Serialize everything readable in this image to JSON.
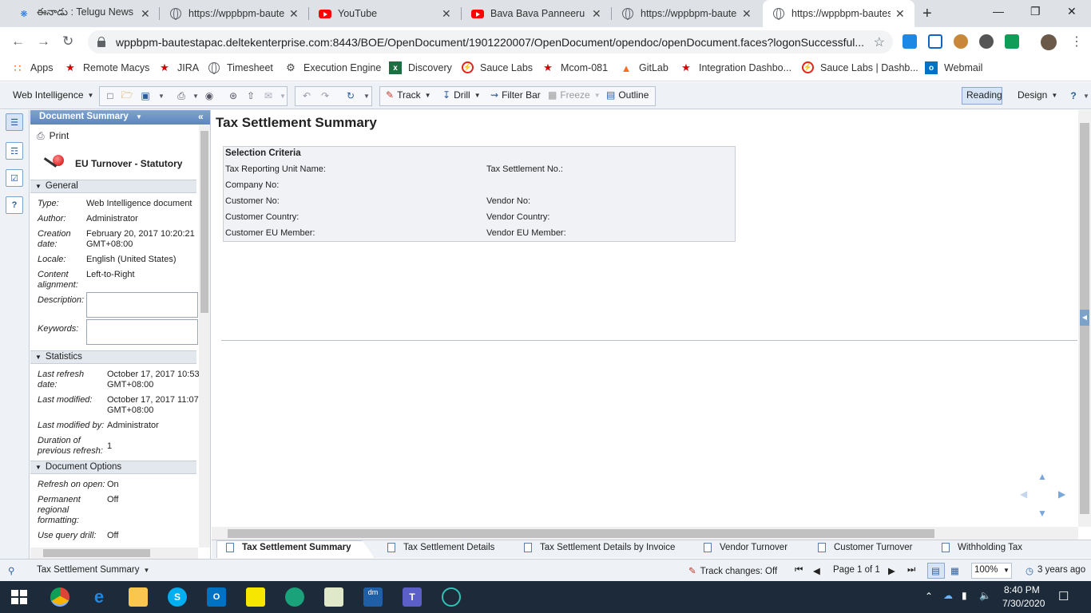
{
  "browser": {
    "tabs": [
      {
        "title": "ఈనాడు : Telugu News |",
        "favicon": "eenadu-icon",
        "active": false
      },
      {
        "title": "https://wppbpm-bautest",
        "favicon": "globe-icon",
        "active": false
      },
      {
        "title": "YouTube",
        "favicon": "youtube-icon",
        "active": false
      },
      {
        "title": "Bava Bava Panneeru Tel",
        "favicon": "youtube-icon",
        "active": false
      },
      {
        "title": "https://wppbpm-bautest",
        "favicon": "globe-icon",
        "active": false
      },
      {
        "title": "https://wppbpm-bautes",
        "favicon": "globe-icon",
        "active": true
      }
    ],
    "url": "wppbpm-bautestapac.deltekenterprise.com:8443/BOE/OpenDocument/1901220007/OpenDocument/opendoc/openDocument.faces?logonSuccessful...",
    "bookmarks": [
      {
        "label": "Apps",
        "icon": "apps-grid-icon"
      },
      {
        "label": "Remote Macys",
        "icon": "star-icon"
      },
      {
        "label": "JIRA",
        "icon": "star-icon"
      },
      {
        "label": "Timesheet",
        "icon": "globe-icon"
      },
      {
        "label": "Execution Engine",
        "icon": "gear-icon"
      },
      {
        "label": "Discovery",
        "icon": "excel-icon"
      },
      {
        "label": "Sauce Labs",
        "icon": "sauce-labs-icon"
      },
      {
        "label": "Mcom-081",
        "icon": "star-icon"
      },
      {
        "label": "GitLab",
        "icon": "gitlab-icon"
      },
      {
        "label": "Integration Dashbo...",
        "icon": "star-icon"
      },
      {
        "label": "Sauce Labs | Dashb...",
        "icon": "sauce-labs-icon"
      },
      {
        "label": "Webmail",
        "icon": "outlook-icon"
      }
    ]
  },
  "toolbar": {
    "web_intelligence": "Web Intelligence",
    "track": "Track",
    "drill": "Drill",
    "filter_bar": "Filter Bar",
    "freeze": "Freeze",
    "outline": "Outline",
    "reading": "Reading",
    "design": "Design"
  },
  "panel": {
    "header": "Document Summary",
    "print": "Print",
    "doc_name": "EU Turnover - Statutory",
    "general": {
      "title": "General",
      "type_label": "Type:",
      "type_value": "Web Intelligence document",
      "author_label": "Author:",
      "author_value": "Administrator",
      "creation_label_1": "Creation",
      "creation_label_2": "date:",
      "creation_value_1": "February 20, 2017 10:20:21",
      "creation_value_2": "GMT+08:00",
      "locale_label": "Locale:",
      "locale_value": "English (United States)",
      "content_label_1": "Content",
      "content_label_2": "alignment:",
      "content_value": "Left-to-Right",
      "description_label": "Description:",
      "keywords_label": "Keywords:"
    },
    "statistics": {
      "title": "Statistics",
      "last_refresh_label_1": "Last refresh",
      "last_refresh_label_2": "date:",
      "last_refresh_value_1": "October 17, 2017 10:53",
      "last_refresh_value_2": "GMT+08:00",
      "last_modified_label": "Last modified:",
      "last_modified_value_1": "October 17, 2017 11:07",
      "last_modified_value_2": "GMT+08:00",
      "last_modified_by_label": "Last modified by:",
      "last_modified_by_value": "Administrator",
      "duration_label_1": "Duration of",
      "duration_label_2": "previous refresh:",
      "duration_value": "1"
    },
    "options": {
      "title": "Document Options",
      "refresh_label": "Refresh on open:",
      "refresh_value": "On",
      "permanent_label_1": "Permanent",
      "permanent_label_2": "regional",
      "permanent_label_3": "formatting:",
      "permanent_value": "Off",
      "query_drill_label": "Use query drill:",
      "query_drill_value": "Off"
    }
  },
  "report": {
    "title": "Tax Settlement Summary",
    "criteria_title": "Selection Criteria",
    "criteria_left": [
      "Tax Reporting Unit Name:",
      "Company No:",
      "Customer No:",
      "Customer Country:",
      "Customer EU Member:"
    ],
    "criteria_right": [
      "Tax Settlement No.:",
      "",
      "Vendor No:",
      "Vendor Country:",
      "Vendor EU Member:"
    ]
  },
  "report_tabs": [
    {
      "label": "Tax Settlement Summary",
      "active": true
    },
    {
      "label": "Tax Settlement Details",
      "active": false
    },
    {
      "label": "Tax Settlement Details by Invoice",
      "active": false
    },
    {
      "label": "Vendor Turnover",
      "active": false
    },
    {
      "label": "Customer Turnover",
      "active": false
    },
    {
      "label": "Withholding Tax",
      "active": false
    }
  ],
  "status": {
    "report_name": "Tax Settlement Summary",
    "track_changes": "Track changes: Off",
    "page": "Page 1 of 1",
    "zoom": "100%",
    "age": "3 years ago"
  },
  "taskbar": {
    "time": "8:40 PM",
    "date": "7/30/2020"
  },
  "colors": {
    "accent": "#5d86bd",
    "chrome_tabstrip": "#dee1e6",
    "taskbar": "#1c2a3a"
  }
}
